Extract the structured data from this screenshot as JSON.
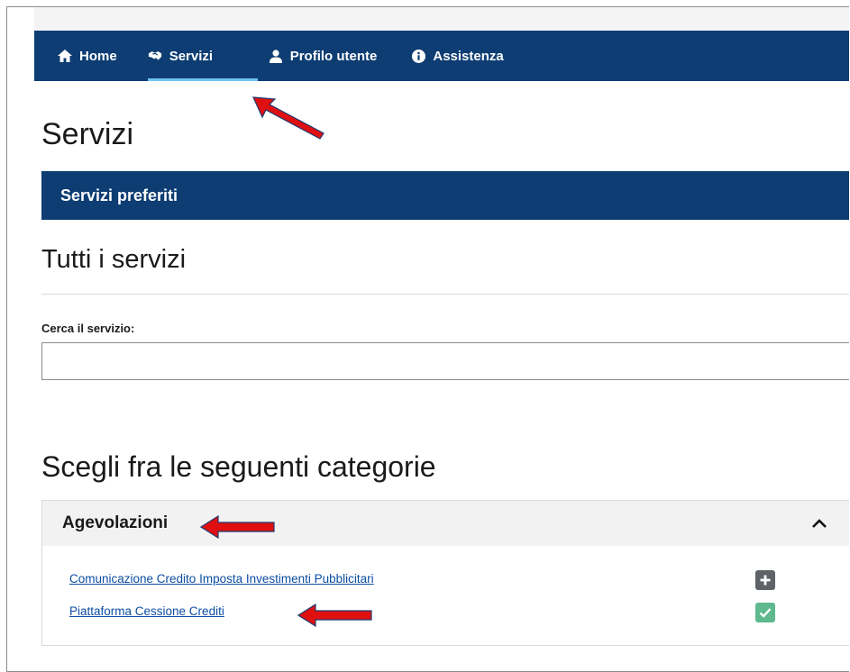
{
  "nav": {
    "items": [
      {
        "label": "Home",
        "icon": "home-icon",
        "active": false
      },
      {
        "label": "Servizi",
        "icon": "handshake-icon",
        "active": true
      },
      {
        "label": "Profilo utente",
        "icon": "user-icon",
        "active": false
      },
      {
        "label": "Assistenza",
        "icon": "info-icon",
        "active": false
      }
    ],
    "active_underline_color": "#6fc2ee",
    "background_color": "#0d3d73"
  },
  "page": {
    "title": "Servizi",
    "preferiti_label": "Servizi preferiti",
    "all_services_title": "Tutti i servizi",
    "categories_title": "Scegli fra le seguenti categorie"
  },
  "search": {
    "label": "Cerca il servizio:",
    "value": "",
    "placeholder": ""
  },
  "accordion": {
    "title": "Agevolazioni",
    "expanded": true,
    "services": [
      {
        "label": "Comunicazione Credito Imposta Investimenti Pubblicitari",
        "action": "add",
        "action_icon": "plus-icon",
        "favorite": false
      },
      {
        "label": "Piattaforma Cessione Crediti",
        "action": "added",
        "action_icon": "check-icon",
        "favorite": true
      }
    ]
  },
  "annotations": {
    "arrow_color": "#e01010"
  }
}
